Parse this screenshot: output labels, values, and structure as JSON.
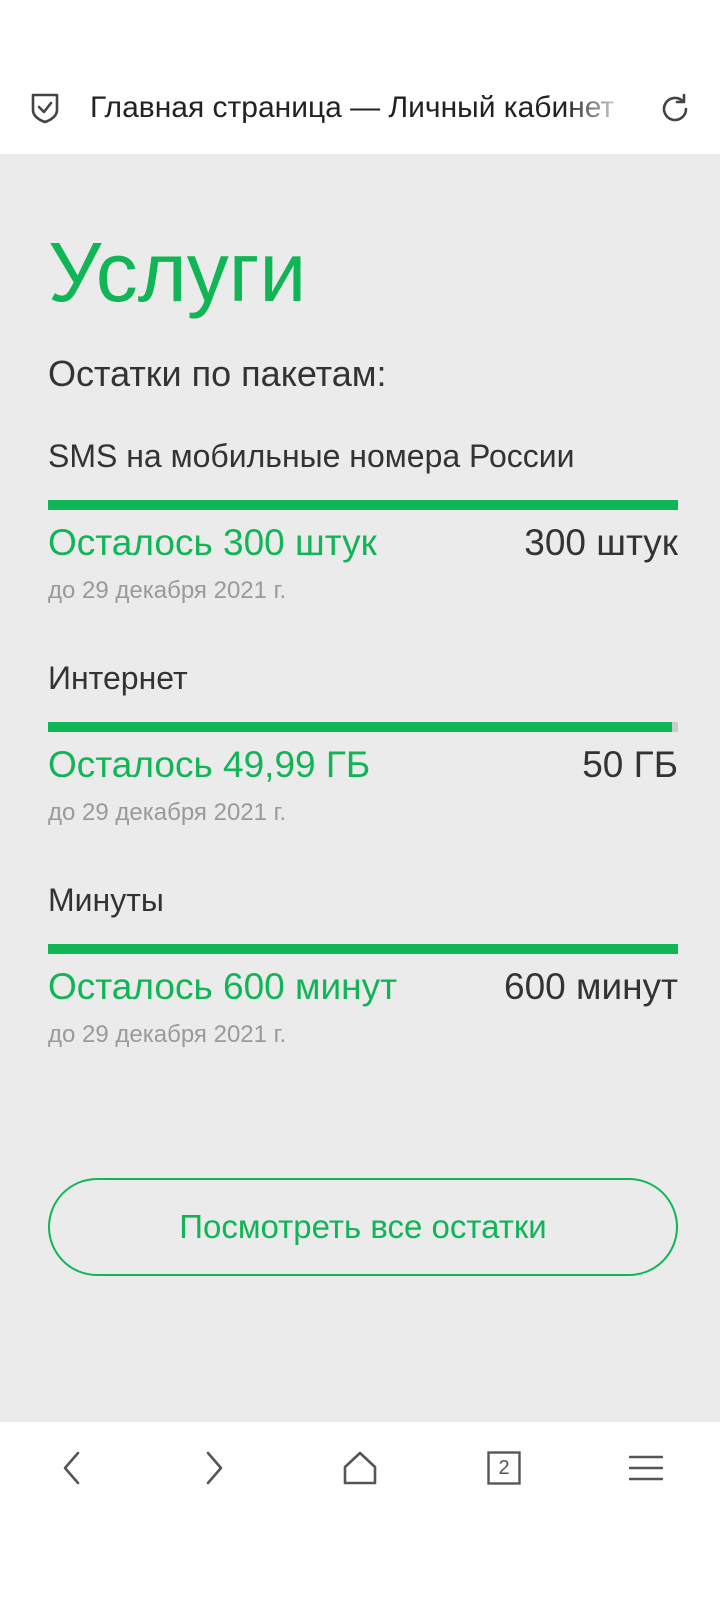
{
  "browser": {
    "page_title": "Главная страница — Личный кабинет",
    "tabs_count": "2"
  },
  "page": {
    "title": "Услуги",
    "subtitle": "Остатки по пакетам:"
  },
  "packages": [
    {
      "name": "SMS на мобильные номера России",
      "remaining_label": "Осталось 300 штук",
      "total_label": "300 штук",
      "valid_until": "до 29 декабря 2021 г.",
      "remaining_fraction": 1.0
    },
    {
      "name": "Интернет",
      "remaining_label": "Осталось 49,99 ГБ",
      "total_label": "50 ГБ",
      "valid_until": "до 29 декабря 2021 г.",
      "remaining_fraction": 0.9998
    },
    {
      "name": "Минуты",
      "remaining_label": "Осталось 600 минут",
      "total_label": "600 минут",
      "valid_until": "до 29 декабря 2021 г.",
      "remaining_fraction": 1.0
    }
  ],
  "actions": {
    "view_all_label": "Посмотреть все остатки"
  },
  "colors": {
    "accent": "#10b556",
    "content_background": "#ebebeb",
    "text": "#333333",
    "muted_text": "#9a9a9a"
  },
  "icons": {
    "address_left": "shield-check-icon",
    "address_right": "reload-icon",
    "nav": [
      "back-arrow-icon",
      "forward-arrow-icon",
      "home-icon",
      "tabs-icon",
      "menu-icon"
    ]
  }
}
